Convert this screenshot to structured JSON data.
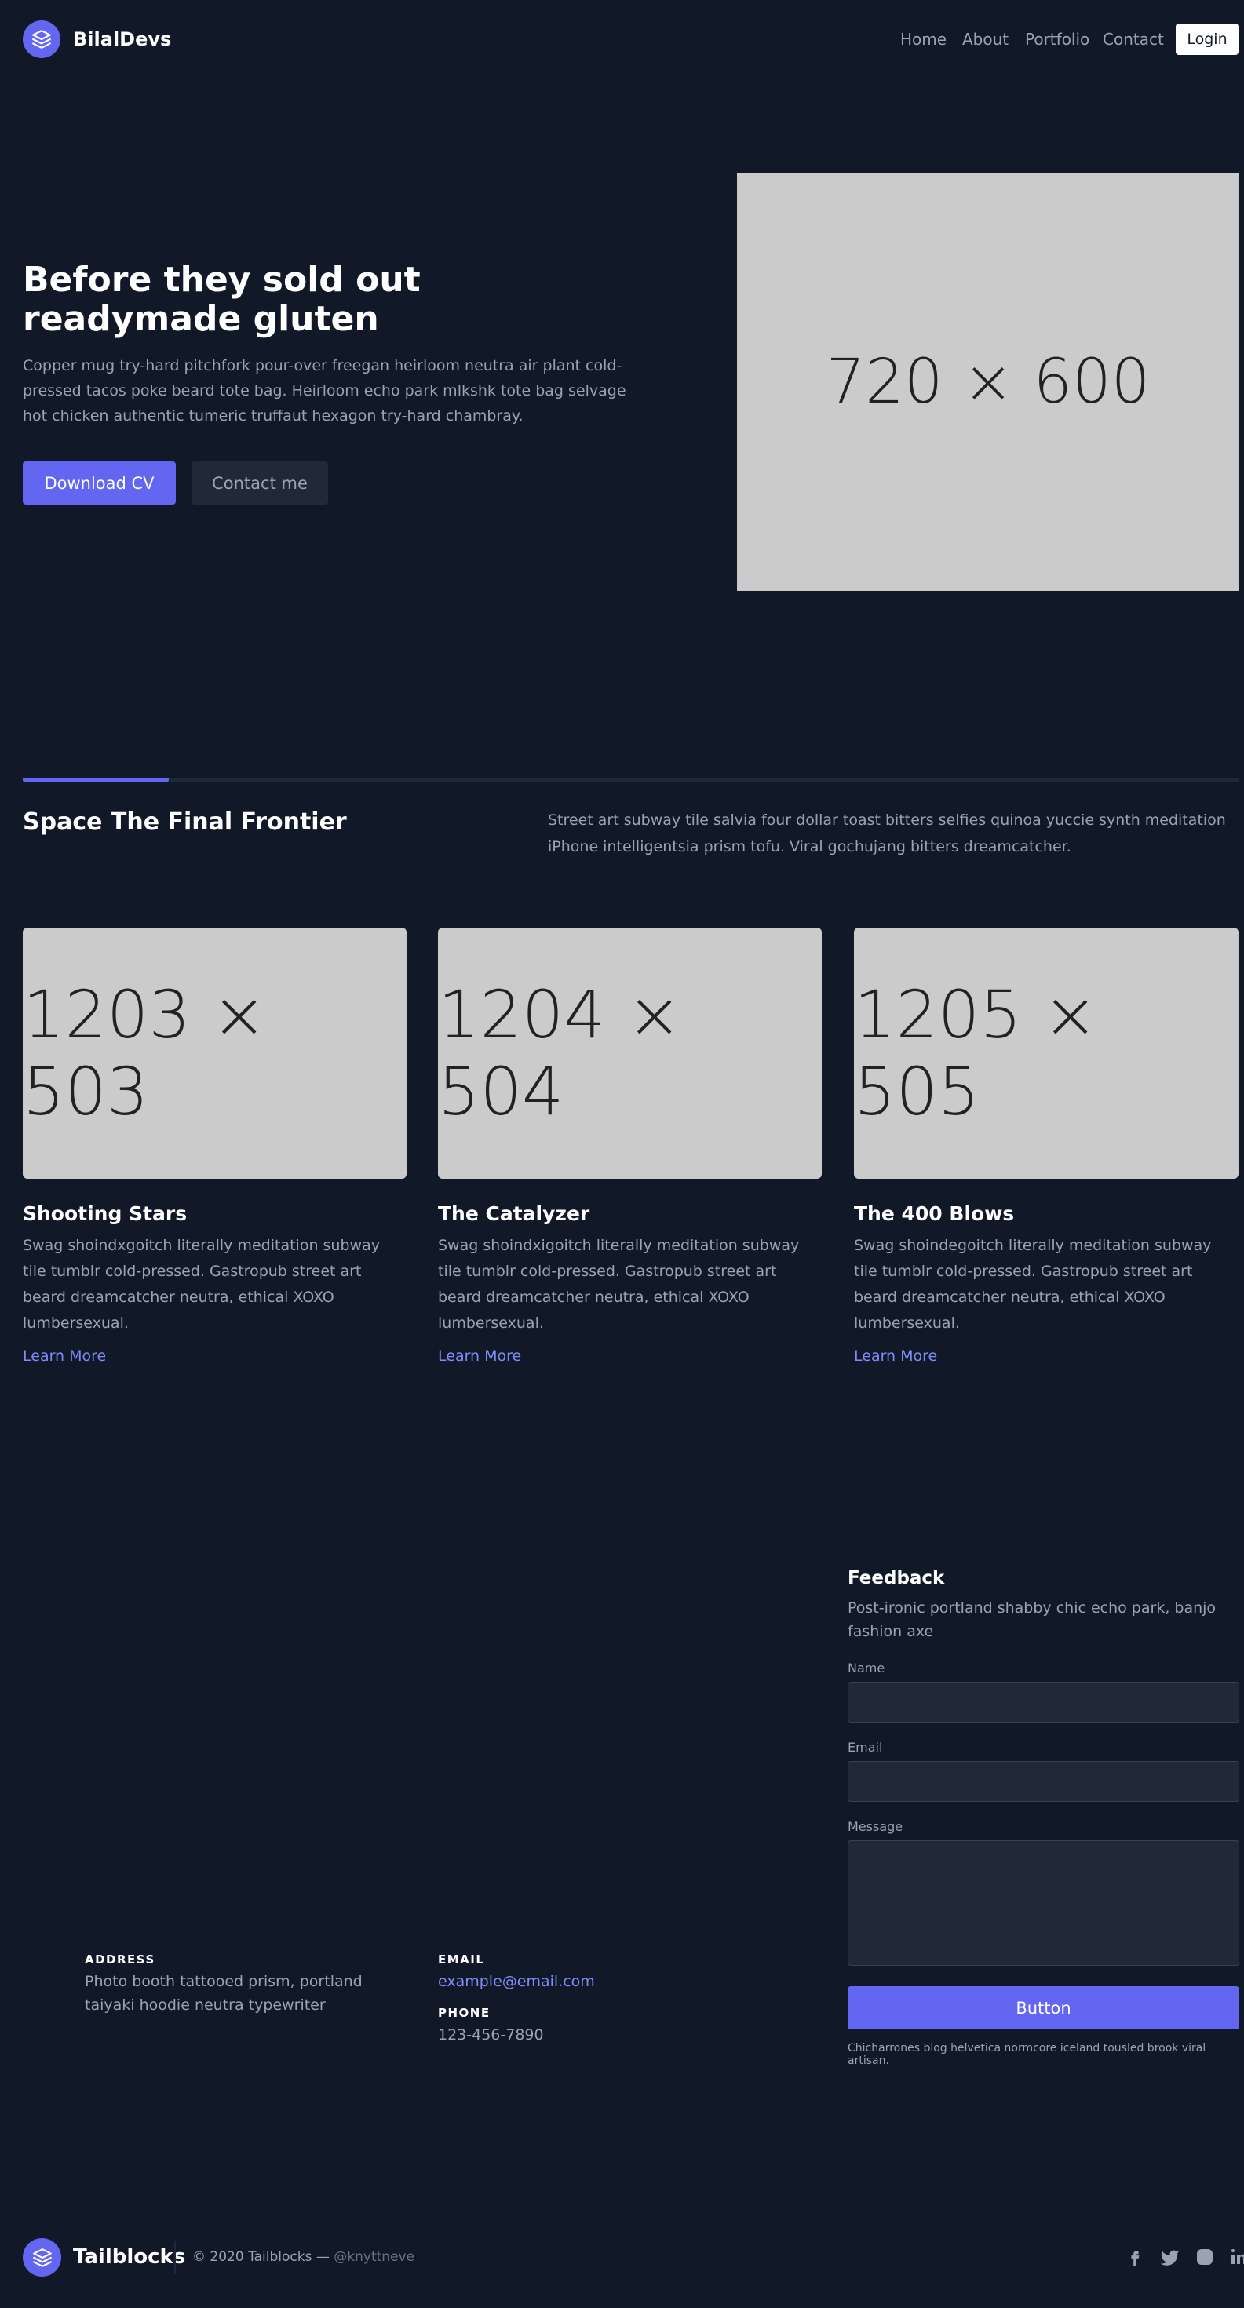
{
  "header": {
    "brand": "BilalDevs",
    "nav": [
      "Home",
      "About",
      "Portfolio",
      "Contact"
    ],
    "login_label": "Login"
  },
  "hero": {
    "title_line1": "Before they sold out",
    "title_line2": "readymade gluten",
    "text": "Copper mug try-hard pitchfork pour-over freegan heirloom neutra air plant cold-pressed tacos poke beard tote bag. Heirloom echo park mlkshk tote bag selvage hot chicken authentic tumeric truffaut hexagon try-hard chambray.",
    "primary_button": "Download CV",
    "secondary_button": "Contact me",
    "image_label": "720 × 600"
  },
  "section": {
    "title": "Space The Final Frontier",
    "description": "Street art subway tile salvia four dollar toast bitters selfies quinoa yuccie synth meditation iPhone intelligentsia prism tofu. Viral gochujang bitters dreamcatcher.",
    "progress": 0.12
  },
  "cards": [
    {
      "image_label": "1203 × 503",
      "title": "Shooting Stars",
      "text": "Swag shoindxgoitch literally meditation subway tile tumblr cold-pressed. Gastropub street art beard dreamcatcher neutra, ethical XOXO lumbersexual.",
      "link": "Learn More"
    },
    {
      "image_label": "1204 × 504",
      "title": "The Catalyzer",
      "text": "Swag shoindxigoitch literally meditation subway tile tumblr cold-pressed. Gastropub street art beard dreamcatcher neutra, ethical XOXO lumbersexual.",
      "link": "Learn More"
    },
    {
      "image_label": "1205 × 505",
      "title": "The 400 Blows",
      "text": "Swag shoindegoitch literally meditation subway tile tumblr cold-pressed. Gastropub street art beard dreamcatcher neutra, ethical XOXO lumbersexual.",
      "link": "Learn More"
    }
  ],
  "contact": {
    "address_label": "ADDRESS",
    "address": "Photo booth tattooed prism, portland taiyaki hoodie neutra typewriter",
    "email_label": "EMAIL",
    "email": "example@email.com",
    "phone_label": "PHONE",
    "phone": "123-456-7890"
  },
  "feedback": {
    "title": "Feedback",
    "description": "Post-ironic portland shabby chic echo park, banjo fashion axe",
    "name_label": "Name",
    "email_label": "Email",
    "message_label": "Message",
    "button": "Button",
    "note": "Chicharrones blog helvetica normcore iceland tousled brook viral artisan."
  },
  "footer": {
    "brand": "Tailblocks",
    "copyright": "© 2020 Tailblocks —",
    "handle": "@knyttneve",
    "social_icons": [
      "facebook-icon",
      "twitter-icon",
      "instagram-icon",
      "linkedin-icon"
    ]
  },
  "colors": {
    "background": "#111827",
    "accent": "#6366f1",
    "link": "#818cf8"
  }
}
